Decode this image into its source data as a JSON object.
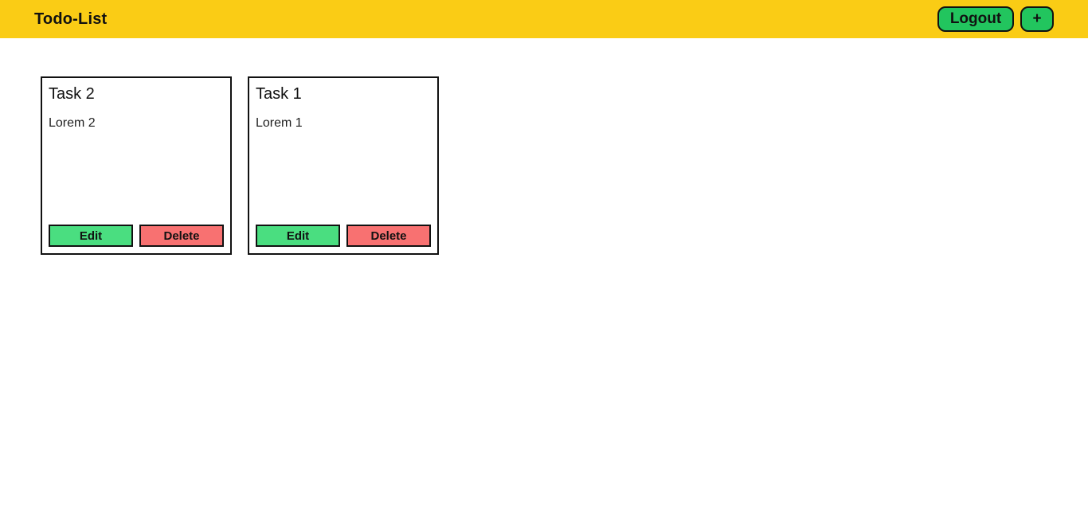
{
  "navbar": {
    "brand": "Todo-List",
    "logout_label": "Logout",
    "add_label": "+"
  },
  "colors": {
    "navbar_bg": "#facc15",
    "primary_green": "#22c55e",
    "edit_green": "#4ade80",
    "delete_red": "#f87171"
  },
  "tasks": [
    {
      "title": "Task 2",
      "description": "Lorem 2",
      "edit_label": "Edit",
      "delete_label": "Delete"
    },
    {
      "title": "Task 1",
      "description": "Lorem 1",
      "edit_label": "Edit",
      "delete_label": "Delete"
    }
  ]
}
